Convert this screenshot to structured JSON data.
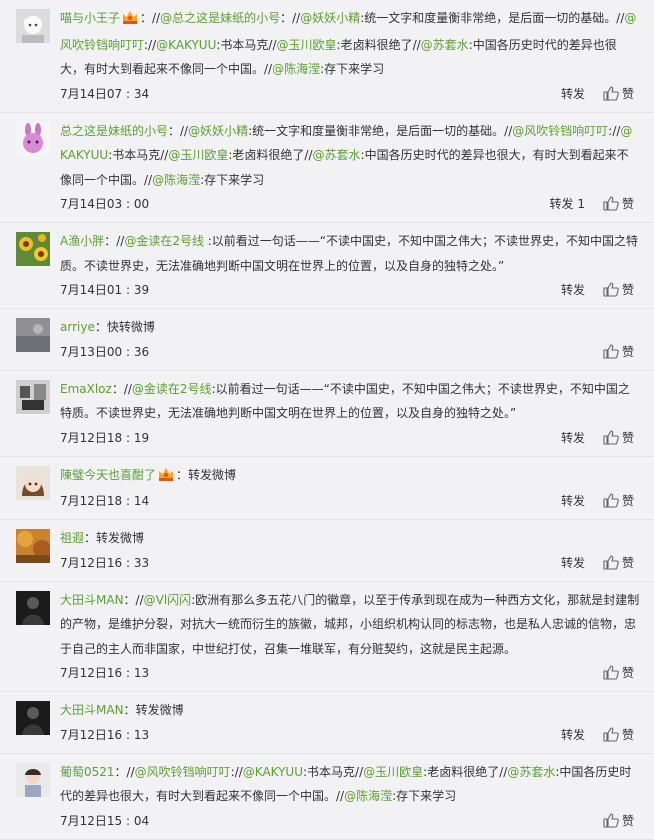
{
  "labels": {
    "repost": "转发",
    "like": "赞"
  },
  "posts": [
    {
      "author": "喵与小王子",
      "badge": "vip-crown-icon",
      "prefix": "：//",
      "segments": [
        {
          "t": "@总之这是妹纸的小号",
          "m": true
        },
        {
          "t": "：//",
          "m": false
        },
        {
          "t": "@妖妖小精",
          "m": true
        },
        {
          "t": ":统一文字和度量衡非常绝，是后面一切的基础。//",
          "m": false
        },
        {
          "t": "@风吹铃铛响叮叮",
          "m": true
        },
        {
          "t": "://",
          "m": false
        },
        {
          "t": "@KAKYUU",
          "m": true
        },
        {
          "t": ":书本马克//",
          "m": false
        },
        {
          "t": "@玉川欧皇",
          "m": true
        },
        {
          "t": ":老卤料很绝了//",
          "m": false
        },
        {
          "t": "@苏套水",
          "m": true
        },
        {
          "t": ":中国各历史时代的差异也很大，有时大到看起来不像同一个中国。//",
          "m": false
        },
        {
          "t": "@陈海滢",
          "m": true
        },
        {
          "t": ":存下来学习",
          "m": false
        }
      ],
      "date": "7月14日07 : 34",
      "repost": "转发",
      "avatar": "cat-avatar"
    },
    {
      "author": "总之这是妹纸的小号",
      "badge": "",
      "prefix": "：//",
      "segments": [
        {
          "t": "@妖妖小精",
          "m": true
        },
        {
          "t": ":统一文字和度量衡非常绝，是后面一切的基础。//",
          "m": false
        },
        {
          "t": "@风吹铃铛响叮叮",
          "m": true
        },
        {
          "t": "://",
          "m": false
        },
        {
          "t": "@KAKYUU",
          "m": true
        },
        {
          "t": ":书本马克//",
          "m": false
        },
        {
          "t": "@玉川欧皇",
          "m": true
        },
        {
          "t": ":老卤料很绝了//",
          "m": false
        },
        {
          "t": "@苏套水",
          "m": true
        },
        {
          "t": ":中国各历史时代的差异也很大，有时大到看起来不像同一个中国。//",
          "m": false
        },
        {
          "t": "@陈海滢",
          "m": true
        },
        {
          "t": ":存下来学习",
          "m": false
        }
      ],
      "date": "7月14日03 : 00",
      "repost": "转发 1",
      "avatar": "bunny-avatar"
    },
    {
      "author": "A渔小胖",
      "badge": "",
      "prefix": "：//",
      "segments": [
        {
          "t": "@金读在2号线",
          "m": true
        },
        {
          "t": " :以前看过一句话——“不读中国史，不知中国之伟大；不读世界史，不知中国之特质。不读世界史，无法准确地判断中国文明在世界上的位置，以及自身的独特之处。”",
          "m": false
        }
      ],
      "date": "7月14日01 : 39",
      "repost": "转发",
      "avatar": "sunflower-avatar"
    },
    {
      "author": "arriye",
      "badge": "",
      "prefix": "：",
      "segments": [
        {
          "t": "快转微博",
          "m": false
        }
      ],
      "date": "7月13日00 : 36",
      "repost": "",
      "avatar": "gray-avatar"
    },
    {
      "author": "EmaXloz",
      "badge": "",
      "prefix": "：//",
      "segments": [
        {
          "t": "@金读在2号线",
          "m": true
        },
        {
          "t": ":以前看过一句话——“不读中国史，不知中国之伟大；不读世界史，不知中国之特质。不读世界史，无法准确地判断中国文明在世界上的位置，以及自身的独特之处。”",
          "m": false
        }
      ],
      "date": "7月12日18 : 19",
      "repost": "转发",
      "avatar": "bw-avatar"
    },
    {
      "author": "陳璧今天也喜酣了",
      "badge": "vip-crown-icon",
      "prefix": "：",
      "segments": [
        {
          "t": "转发微博",
          "m": false
        }
      ],
      "date": "7月12日18 : 14",
      "repost": "转发",
      "avatar": "girl-avatar"
    },
    {
      "author": "祖遐",
      "badge": "",
      "prefix": "：",
      "segments": [
        {
          "t": "转发微博",
          "m": false
        }
      ],
      "date": "7月12日16 : 33",
      "repost": "转发",
      "avatar": "autumn-avatar"
    },
    {
      "author": "大田斗MAN",
      "badge": "",
      "prefix": "：//",
      "segments": [
        {
          "t": "@Vl闪闪",
          "m": true
        },
        {
          "t": ":欧洲有那么多五花八门的徽章，以至于传承到现在成为一种西方文化，那就是封建制的产物，是维护分裂，对抗大一统而衍生的族徽，城邦，小组织机构认同的标志物，也是私人忠诚的信物，忠于自己的主人而非国家，中世纪打仗，召集一堆联军，有分赃契约，这就是民主起源。",
          "m": false
        }
      ],
      "date": "7月12日16 : 13",
      "repost": "",
      "avatar": "dark-avatar"
    },
    {
      "author": "大田斗MAN",
      "badge": "",
      "prefix": "：",
      "segments": [
        {
          "t": "转发微博",
          "m": false
        }
      ],
      "date": "7月12日16 : 13",
      "repost": "转发",
      "avatar": "dark-avatar"
    },
    {
      "author": "葡萄0521",
      "badge": "",
      "prefix": "：//",
      "segments": [
        {
          "t": "@风吹铃铛响叮叮",
          "m": true
        },
        {
          "t": "://",
          "m": false
        },
        {
          "t": "@KAKYUU",
          "m": true
        },
        {
          "t": ":书本马克//",
          "m": false
        },
        {
          "t": "@玉川欧皇",
          "m": true
        },
        {
          "t": ":老卤料很绝了//",
          "m": false
        },
        {
          "t": "@苏套水",
          "m": true
        },
        {
          "t": ":中国各历史时代的差异也很大，有时大到看起来不像同一个中国。//",
          "m": false
        },
        {
          "t": "@陈海滢",
          "m": true
        },
        {
          "t": ":存下来学习",
          "m": false
        }
      ],
      "date": "7月12日15 : 04",
      "repost": "",
      "avatar": "child-avatar"
    }
  ]
}
